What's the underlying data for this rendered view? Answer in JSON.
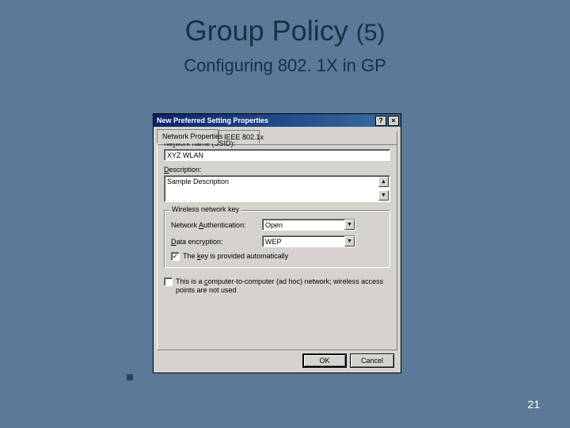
{
  "slide": {
    "title_main": "Group Policy",
    "title_num": "(5)",
    "subtitle": "Configuring 802. 1X in GP",
    "page_number": "21"
  },
  "dialog": {
    "title": "New Preferred Setting Properties",
    "help_btn": "?",
    "close_btn": "×",
    "tabs": {
      "network": "Network Properties",
      "ieee": "IEEE 802.1x"
    },
    "labels": {
      "ssid_prefix": "Ne",
      "ssid_u": "t",
      "ssid_suffix": "work name (SSID):",
      "desc_u": "D",
      "desc_suffix": "escription:",
      "group_title": "Wireless network key",
      "auth_prefix": "Network ",
      "auth_u": "A",
      "auth_suffix": "uthentication:",
      "enc_prefix": "",
      "enc_u": "D",
      "enc_suffix": "ata encryption:",
      "key_prefix": "The ",
      "key_u": "k",
      "key_suffix": "ey is provided automatically",
      "adhoc_prefix": "This is a ",
      "adhoc_u": "c",
      "adhoc_suffix": "omputer-to-computer (ad hoc) network; wireless access points are not used"
    },
    "values": {
      "ssid": "XYZ WLAN",
      "description": "Sample Description",
      "auth": "Open",
      "encryption": "WEP",
      "key_auto_checked": "✓",
      "adhoc_checked": ""
    },
    "buttons": {
      "ok": "OK",
      "cancel": "Cancel"
    }
  }
}
